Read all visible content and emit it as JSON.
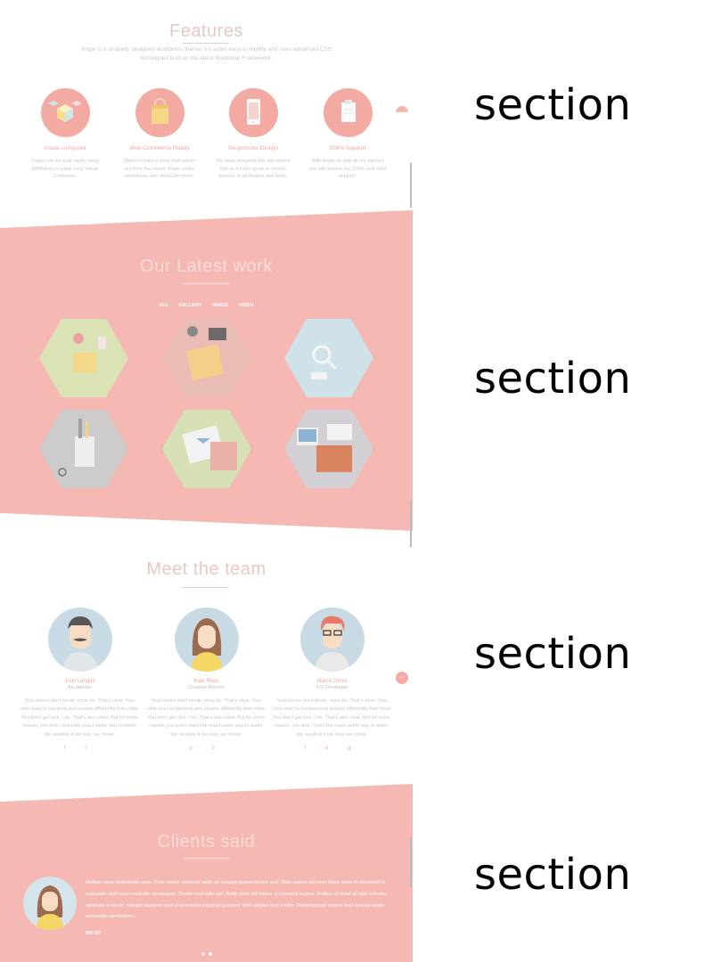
{
  "labels": {
    "section1": "section",
    "section2": "section",
    "section3": "section",
    "section4": "section"
  },
  "features": {
    "title": "Features",
    "intro": "Angle is a uniquely designed wordpress theme. It's super easy to modify and uses advanced CSS techniques built on the latest Bootstrap Framework.",
    "items": [
      {
        "name": "Visual composer",
        "desc": "Pages can be built easily using WPBakery's super easy Visual Composer."
      },
      {
        "name": "Woo Commerce Ready",
        "desc": "Want to make a shop that stands out from the crowd, Angle works seamlessly with WooCommerce."
      },
      {
        "name": "Responsive Design",
        "desc": "We have designed this site mobile first so it looks great on mobile devices of all shapes and sizes."
      },
      {
        "name": "100% Support",
        "desc": "With Angle as with all our themes you will receive our 100% rock solid support."
      }
    ]
  },
  "work": {
    "title": "Our Latest work",
    "filters": [
      "ALL",
      "GALLERY",
      "IMAGE",
      "VIDEO"
    ]
  },
  "team": {
    "title": "Meet the team",
    "members": [
      {
        "name": "John Langan",
        "role": "Art director",
        "bio": "Your bones don't break, mine do. That's clear. Your cells react to bacteria and viruses differently than mine. You don't get sick, I do. That's also clear. But for some reason, you and I react the exact same way to water. We swallow it too fast, we choke.",
        "social": "f t"
      },
      {
        "name": "Kate Ross",
        "role": "Creative director",
        "bio": "Your bones don't break, mine do. That's clear. Your cells react to bacteria and viruses differently than mine. You don't get sick, I do. That's also clear. But for some reason, you and I react the exact same way to water. We swallow it too fast, we choke.",
        "social": "p o"
      },
      {
        "name": "Marco Jones",
        "role": "iOS Developer",
        "bio": "Your bones don't break, mine do. That's clear. Your cells react to bacteria and viruses differently than mine. You don't get sick, I do. That's also clear. But for some reason, you and I react the exact same way to water. We swallow it too fast, we choke.",
        "social": "f o g"
      }
    ]
  },
  "clients": {
    "title": "Clients said",
    "quote": "Nullam vitae sollicitudin eros. Cras varius vehicula velit, ac congue quam dictum sed. Duis autem vel eum iriure dolor in hendrerit in vulputate velit esse molestie consequat. Donec sed odio dui. Nulla vitae elit libero, a pharetra augue. Nullam id dolor id nibh ultricies vehicula ut id elit. Integer posuere erat a venenatis dapibus posuere velit aliquet duis mollis. Pellentesque ornare sem lacinia quam venenatis vestibulum.",
    "name": "Bill Gill"
  },
  "colors": {
    "accent": "#f3aaa3",
    "band": "#f5b8b2",
    "text_muted": "#c8c8c8"
  }
}
